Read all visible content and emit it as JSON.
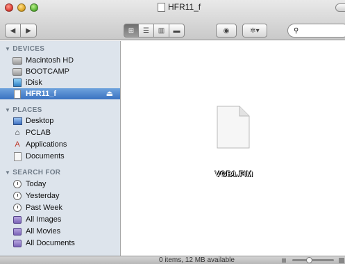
{
  "window": {
    "title": "HFR11_f"
  },
  "toolbar": {
    "back_icon": "◀",
    "forward_icon": "▶",
    "view_icons": [
      "⊞",
      "☰",
      "▥",
      "▬"
    ],
    "quicklook_icon": "◉",
    "action_icon": "✲▾",
    "search_placeholder": ""
  },
  "sidebar": {
    "sections": [
      {
        "title": "DEVICES",
        "items": [
          {
            "label": "Macintosh HD",
            "icon": "hard-drive-icon"
          },
          {
            "label": "BOOTCAMP",
            "icon": "hard-drive-icon"
          },
          {
            "label": "iDisk",
            "icon": "idisk-icon"
          },
          {
            "label": "HFR11_f",
            "icon": "volume-icon",
            "selected": true,
            "eject": "⏏"
          }
        ]
      },
      {
        "title": "PLACES",
        "items": [
          {
            "label": "Desktop",
            "icon": "desktop-icon"
          },
          {
            "label": "PCLAB",
            "icon": "home-icon"
          },
          {
            "label": "Applications",
            "icon": "applications-icon"
          },
          {
            "label": "Documents",
            "icon": "documents-icon"
          }
        ]
      },
      {
        "title": "SEARCH FOR",
        "items": [
          {
            "label": "Today",
            "icon": "clock-icon"
          },
          {
            "label": "Yesterday",
            "icon": "clock-icon"
          },
          {
            "label": "Past Week",
            "icon": "clock-icon"
          },
          {
            "label": "All Images",
            "icon": "smart-folder-icon"
          },
          {
            "label": "All Movies",
            "icon": "smart-folder-icon"
          },
          {
            "label": "All Documents",
            "icon": "smart-folder-icon"
          }
        ]
      }
    ]
  },
  "content": {
    "file": {
      "name": "VGB1.FIM",
      "icon": "generic-document-icon"
    }
  },
  "status": {
    "text": "0 items, 12 MB available"
  }
}
